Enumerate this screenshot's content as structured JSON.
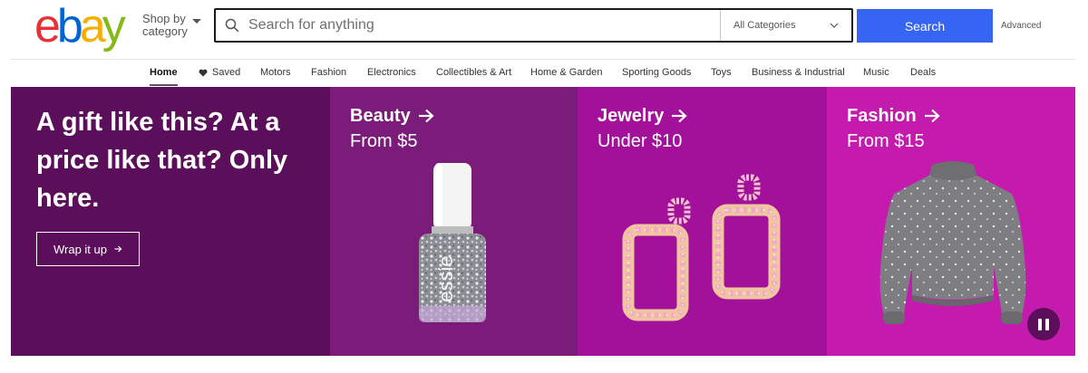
{
  "logo": {
    "letters": [
      "e",
      "b",
      "a",
      "y"
    ],
    "colors": [
      "#e53238",
      "#0064d2",
      "#f5af02",
      "#86b817"
    ]
  },
  "header": {
    "shop_by_line1": "Shop by",
    "shop_by_line2": "category",
    "search_placeholder": "Search for anything",
    "category_select": "All Categories",
    "search_button": "Search",
    "advanced_link": "Advanced"
  },
  "nav": {
    "items": [
      "Home",
      "Saved",
      "Motors",
      "Fashion",
      "Electronics",
      "Collectibles & Art",
      "Home & Garden",
      "Sporting Goods",
      "Toys",
      "Business & Industrial",
      "Music",
      "Deals"
    ],
    "active": "Home"
  },
  "hero": {
    "intro_title": "A gift like this? At a price like that? Only here.",
    "cta": "Wrap it up",
    "panels": [
      {
        "title": "Beauty",
        "subtitle": "From $5",
        "image": "nail-polish-bottle",
        "product_text": "essie"
      },
      {
        "title": "Jewelry",
        "subtitle": "Under $10",
        "image": "square-earrings"
      },
      {
        "title": "Fashion",
        "subtitle": "From $15",
        "image": "grey-sweater"
      }
    ]
  },
  "colors": {
    "search_button": "#3665f3",
    "intro_bg": "#5b0f5a",
    "beauty_bg": "#7b1c7a",
    "jewelry_bg": "#a3119a",
    "fashion_bg": "#c41aae"
  }
}
